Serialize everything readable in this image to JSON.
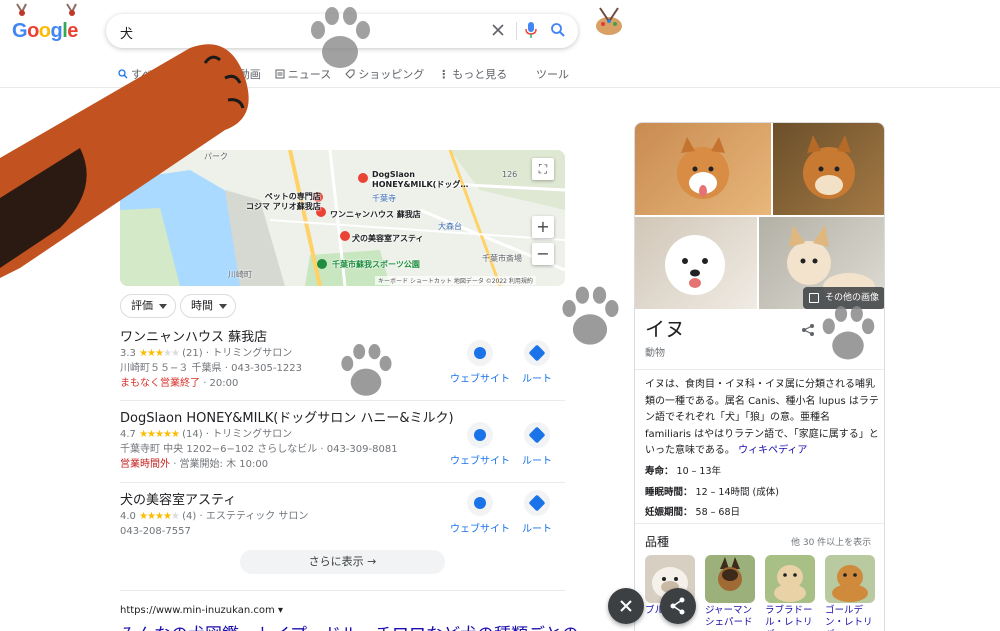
{
  "header": {
    "logo_text": "Google",
    "search_query": "犬"
  },
  "tabs": [
    {
      "label": "すべて"
    },
    {
      "label": "画像"
    },
    {
      "label": "動画"
    },
    {
      "label": "ニュース"
    },
    {
      "label": "ショッピング"
    },
    {
      "label": "もっと見る"
    }
  ],
  "tools_label": "ツール",
  "map": {
    "labels": {
      "park": "パーク",
      "pet_shop": "ペットの専門店\nコジマ アリオ蘇我店",
      "dogsalon": "DogSlaon\nHONEY&MILK(ドッグ…",
      "chiba_dera": "千葉寺",
      "wan": "ワンニャンハウス 蘇我店",
      "omori": "大森台",
      "asuti": "犬の美容室アスティ",
      "sports_park": "千葉市蘇我スポーツ公園",
      "kawasaki": "川崎町",
      "market": "千葉市斎場",
      "road_126": "126",
      "station_fragment": "千葉ポート",
      "footer": "キーボード ショートカット  地図データ ©2022  利用規約"
    }
  },
  "filters": {
    "rating": "評価",
    "hours": "時間"
  },
  "listings": [
    {
      "name": "ワンニャンハウス 蘇我店",
      "rating": "3.3",
      "reviews": "(21)",
      "category": "トリミングサロン",
      "address": "川崎町５５−３ 千葉県 · 043-305-1223",
      "status": "まもなく営業終了",
      "status_extra": "· 20:00"
    },
    {
      "name": "DogSlaon HONEY&MILK(ドッグサロン ハニー&ミルク)",
      "rating": "4.7",
      "reviews": "(14)",
      "category": "トリミングサロン",
      "address": "千葉寺町 中央 1202−6−102 さらしなビル · 043-309-8081",
      "status": "営業時間外",
      "status_extra": "· 営業開始: 木 10:00"
    },
    {
      "name": "犬の美容室アスティ",
      "rating": "4.0",
      "reviews": "(4)",
      "category": "エステティック サロン",
      "address": "043-208-7557",
      "status": "",
      "status_extra": ""
    }
  ],
  "actions": {
    "website": "ウェブサイト",
    "route": "ルート"
  },
  "more_button": "さらに表示",
  "result": {
    "url": "https://www.min-inuzukan.com",
    "title": "みんなの犬図鑑 - トイプードル、チワワなど犬の種類ごとの"
  },
  "knowledge_panel": {
    "more_images": "その他の画像",
    "title": "イヌ",
    "subtitle": "動物",
    "description": "イヌは、食肉目・イヌ科・イヌ属に分類される哺乳類の一種である。属名 Canis、種小名 lupus はラテン語でそれぞれ「犬」「狼」の意。亜種名 familiaris はやはりラテン語で、「家庭に属する」といった意味である。",
    "wiki_link": "ウィキペディア",
    "facts": [
      {
        "label": "寿命：",
        "value": "10 – 13年"
      },
      {
        "label": "睡眠時間：",
        "value": "12 – 14時間 (成体)"
      },
      {
        "label": "妊娠期間：",
        "value": "58 – 68日"
      }
    ],
    "breeds_title": "品種",
    "breeds_more": "他 30 件以上を表示",
    "breeds": [
      {
        "name": "ブルドッグ"
      },
      {
        "name": "ジャーマン シェパード"
      },
      {
        "name": "ラブラドール・レトリバー"
      },
      {
        "name": "ゴールデン・レトリバー"
      }
    ]
  },
  "colors": {
    "link": "#1a0dab",
    "action_blue": "#1a73e8",
    "closed_red": "#d93025",
    "star": "#fbbc04"
  }
}
